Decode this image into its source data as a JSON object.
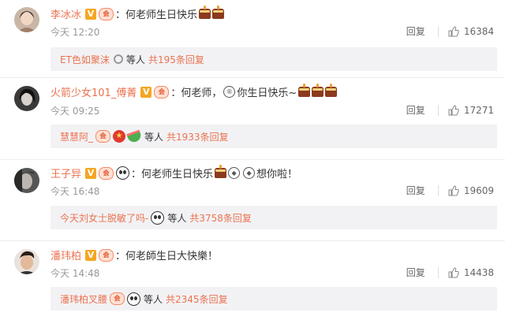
{
  "comments": [
    {
      "name": "李冰冰",
      "badges": [
        "V",
        "vip"
      ],
      "colon": "：",
      "text": "何老师生日快乐",
      "suffix": "",
      "time": "今天 12:20",
      "reply_label": "回复",
      "likes": "16384",
      "reply_preview": {
        "name": "ET色如聚沫",
        "text": "等人",
        "count": "共195条回复"
      }
    },
    {
      "name": "火箭少女101_傅菁",
      "badges": [
        "V",
        "vip"
      ],
      "colon": "：",
      "text": "何老师，",
      "text2": "你生日快乐~",
      "suffix": "",
      "time": "今天 09:25",
      "reply_label": "回复",
      "likes": "17271",
      "reply_preview": {
        "name": "慧慧阿_",
        "text": "等人",
        "count": "共1933条回复"
      }
    },
    {
      "name": "王子异",
      "badges": [
        "V",
        "vip",
        "panda"
      ],
      "colon": "：",
      "text": "何老师生日快乐",
      "text2": "想你啦！",
      "time": "今天 16:48",
      "reply_label": "回复",
      "likes": "19609",
      "reply_preview": {
        "name": "今天刘女士脱敏了吗-",
        "text": "等人",
        "count": "共3758条回复"
      }
    },
    {
      "name": "潘玮柏",
      "badges": [
        "V",
        "vip"
      ],
      "colon": "：",
      "text": "何老師生日大快樂！",
      "time": "今天 14:48",
      "reply_label": "回复",
      "likes": "14438",
      "reply_preview": {
        "name": "潘玮柏叉腰",
        "text": "等人",
        "count": "共2345条回复"
      }
    }
  ],
  "colors": {
    "accent": "#eb7350",
    "meta": "#999999",
    "reply_bg": "#f2f2f5",
    "verified": "#f5a623"
  },
  "icons": {
    "like": "thumbs-up-icon",
    "cake": "birthday-cake-icon",
    "verified": "verified-v-icon",
    "vip": "vip-member-icon"
  }
}
